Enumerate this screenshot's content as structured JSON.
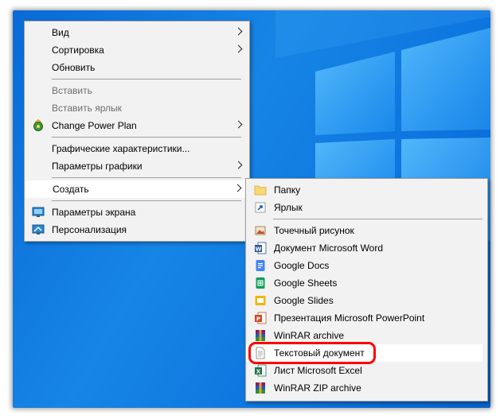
{
  "main_menu": {
    "items": [
      {
        "label": "Вид"
      },
      {
        "label": "Сортировка"
      },
      {
        "label": "Обновить"
      },
      {
        "label": "Вставить"
      },
      {
        "label": "Вставить ярлык"
      },
      {
        "label": "Change Power Plan"
      },
      {
        "label": "Графические характеристики..."
      },
      {
        "label": "Параметры графики"
      },
      {
        "label": "Создать"
      },
      {
        "label": "Параметры экрана"
      },
      {
        "label": "Персонализация"
      }
    ]
  },
  "sub_menu": {
    "items": [
      {
        "label": "Папку"
      },
      {
        "label": "Ярлык"
      },
      {
        "label": "Точечный рисунок"
      },
      {
        "label": "Документ Microsoft Word"
      },
      {
        "label": "Google Docs"
      },
      {
        "label": "Google Sheets"
      },
      {
        "label": "Google Slides"
      },
      {
        "label": "Презентация Microsoft PowerPoint"
      },
      {
        "label": "WinRAR archive"
      },
      {
        "label": "Текстовый документ"
      },
      {
        "label": "Лист Microsoft Excel"
      },
      {
        "label": "WinRAR ZIP archive"
      }
    ]
  },
  "colors": {
    "desktop": "#0d74df",
    "menu_bg": "#f2f2f2",
    "highlight": "#ff0000"
  }
}
